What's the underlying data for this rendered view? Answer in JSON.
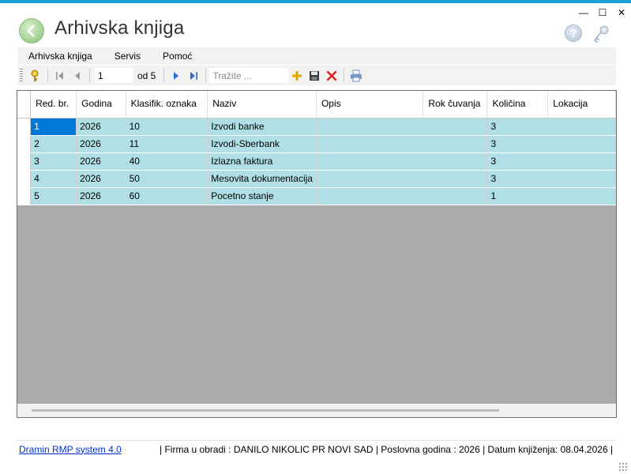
{
  "window": {
    "title": "Arhivska knjiga",
    "controls": {
      "minimize": "—",
      "maximize": "☐",
      "close": "✕"
    }
  },
  "menu": {
    "items": [
      "Arhivska knjiga",
      "Servis",
      "Pomoć"
    ]
  },
  "toolbar": {
    "position": "1",
    "of_label": "od 5",
    "search_placeholder": "Tražite ...",
    "icons": [
      "key-icon",
      "first-record-icon",
      "prev-record-icon",
      "next-record-icon",
      "last-record-icon",
      "add-icon",
      "save-icon",
      "delete-icon",
      "print-icon"
    ]
  },
  "grid": {
    "columns": [
      "Red. br.",
      "Godina",
      "Klasifik. oznaka",
      "Naziv",
      "Opis",
      "Rok čuvanja",
      "Količina",
      "Lokacija"
    ],
    "rows": [
      {
        "red_br": "1",
        "godina": "2026",
        "oznaka": "10",
        "naziv": "Izvodi banke",
        "opis": "",
        "rok": "",
        "kolicina": "3",
        "lokacija": ""
      },
      {
        "red_br": "2",
        "godina": "2026",
        "oznaka": "11",
        "naziv": "Izvodi-Sberbank",
        "opis": "",
        "rok": "",
        "kolicina": "3",
        "lokacija": ""
      },
      {
        "red_br": "3",
        "godina": "2026",
        "oznaka": "40",
        "naziv": "Izlazna faktura",
        "opis": "",
        "rok": "",
        "kolicina": "3",
        "lokacija": ""
      },
      {
        "red_br": "4",
        "godina": "2026",
        "oznaka": "50",
        "naziv": "Mesovita dokumentacija",
        "opis": "",
        "rok": "",
        "kolicina": "3",
        "lokacija": ""
      },
      {
        "red_br": "5",
        "godina": "2026",
        "oznaka": "60",
        "naziv": "Pocetno stanje",
        "opis": "",
        "rok": "",
        "kolicina": "1",
        "lokacija": ""
      }
    ]
  },
  "status": {
    "product": "Dramin RMP system 4.0",
    "info": "|  Firma u obradi : DANILO NIKOLIC PR NOVI SAD  |  Poslovna godina : 2026  |  Datum knjiženja: 08.04.2026  |"
  },
  "colors": {
    "accent": "#1aa0d8",
    "row_bg": "#b0e0e6",
    "selected": "#0078d7",
    "grid_bg": "#ababab"
  }
}
